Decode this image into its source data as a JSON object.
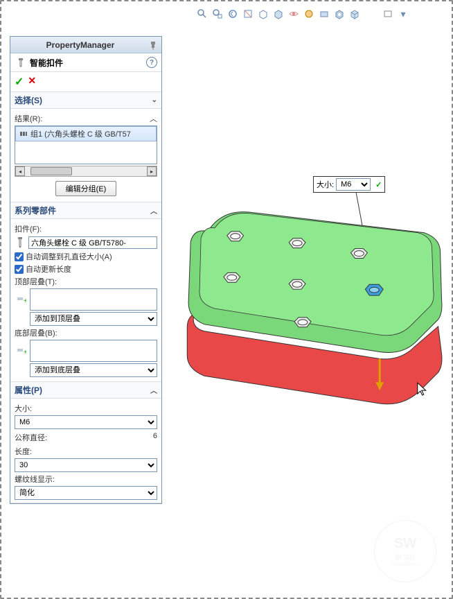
{
  "panel": {
    "header_title": "PropertyManager",
    "sub_title": "智能扣件",
    "help": "?",
    "pin": "📌"
  },
  "confirm": {
    "ok": "✓",
    "cancel": "✕"
  },
  "sections": {
    "select": {
      "title": "选择(S)",
      "chev": "⌄"
    },
    "result": {
      "title": "结果(R):",
      "item": "组1 (六角头螺栓 C 级 GB/T57",
      "edit_btn": "编辑分组(E)",
      "chev": "︿"
    },
    "series": {
      "title": "系列零部件",
      "fastener_label": "扣件(F):",
      "fastener_value": "六角头螺栓 C 级 GB/T5780-",
      "auto_adjust": "自动调整到孔直径大小(A)",
      "auto_update": "自动更新长度",
      "top_stack_label": "顶部层叠(T):",
      "top_stack_select": "添加到顶层叠",
      "bottom_stack_label": "底部层叠(B):",
      "bottom_stack_select": "添加到底层叠",
      "chev": "︿"
    },
    "props": {
      "title": "属性(P)",
      "size_label": "大小:",
      "size_value": "M6",
      "diameter_label": "公称直径:",
      "diameter_value": "6",
      "length_label": "长度:",
      "length_value": "30",
      "thread_label": "螺纹线显示:",
      "thread_value": "简化",
      "chev": "︿"
    }
  },
  "callout": {
    "label": "大小:",
    "value": "M6",
    "dropdown_arrow": "▼",
    "ok": "✓"
  },
  "watermark": {
    "line1": "SW",
    "line2": "研习社",
    "line3": "© SolidWorks"
  }
}
